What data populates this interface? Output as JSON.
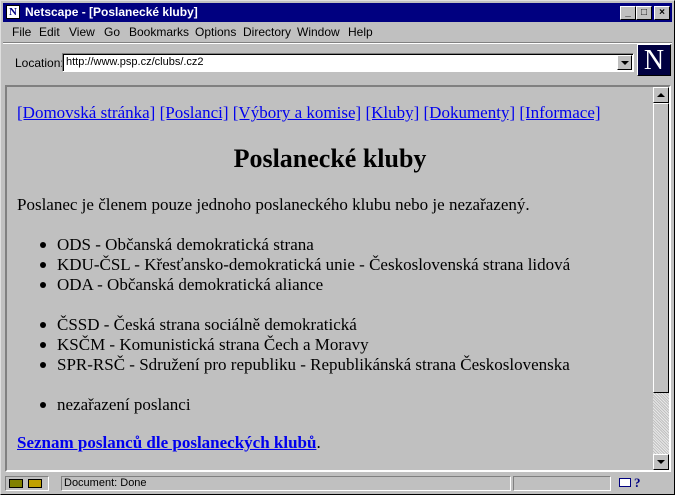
{
  "window": {
    "title": "Netscape - [Poslanecké kluby]"
  },
  "menu": [
    "File",
    "Edit",
    "View",
    "Go",
    "Bookmarks",
    "Options",
    "Directory",
    "Window",
    "Help"
  ],
  "location": {
    "label": "Location:",
    "url": "http://www.psp.cz/clubs/.cz2"
  },
  "page": {
    "nav": [
      "[Domovská stránka]",
      "[Poslanci]",
      "[Výbory a komise]",
      "[Kluby]",
      "[Dokumenty]",
      "[Informace]"
    ],
    "heading": "Poslanecké kluby",
    "intro": "Poslanec je členem pouze jednoho poslaneckého klubu nebo je nezařazený.",
    "groups": [
      [
        "ODS - Občanská demokratická strana",
        "KDU-ČSL - Křesťansko-demokratická unie - Československá strana lidová",
        "ODA - Občanská demokratická aliance"
      ],
      [
        "ČSSD - Česká strana sociálně demokratická",
        "KSČM - Komunistická strana Čech a Moravy",
        "SPR-RSČ - Sdružení pro republiku - Republikánská strana Československa"
      ],
      [
        "nezařazení poslanci"
      ]
    ],
    "footer_link": "Seznam poslanců dle poslaneckých klubů",
    "footer_suffix": "."
  },
  "status": {
    "text": "Document: Done"
  },
  "icons": {
    "app": "netscape-icon",
    "minimize": "minimize-icon",
    "maximize": "maximize-icon",
    "close": "close-icon",
    "throbber": "netscape-n-logo",
    "mail": "mail-icon",
    "help": "help-icon"
  },
  "colors": {
    "titlebar": "#000080",
    "link": "#0000ee",
    "chrome": "#c0c0c0"
  }
}
